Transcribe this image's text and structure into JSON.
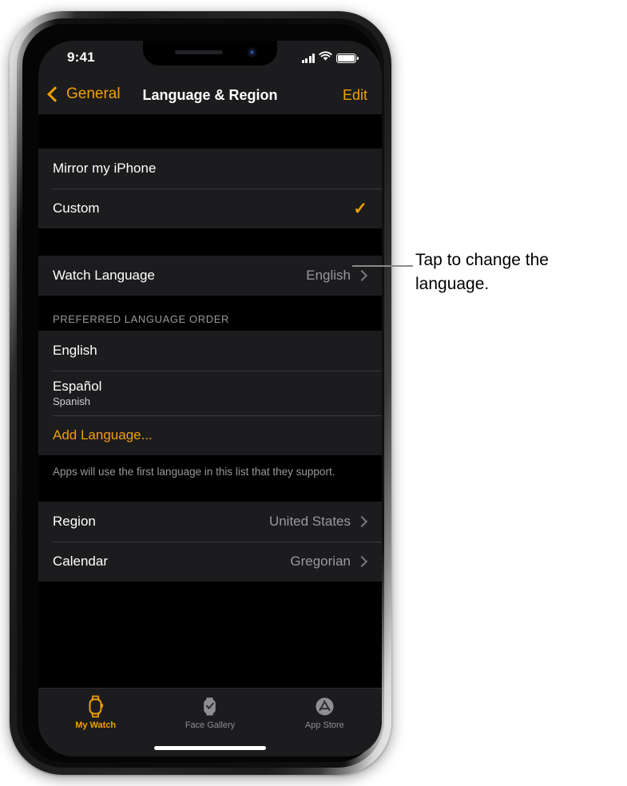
{
  "status_bar": {
    "time": "9:41",
    "signal_icon": "cellular-signal-icon",
    "wifi_icon": "wifi-icon",
    "battery_icon": "battery-icon"
  },
  "nav_bar": {
    "back_label": "General",
    "title": "Language & Region",
    "edit_label": "Edit"
  },
  "groups": {
    "mirror": {
      "rows": [
        {
          "label": "Mirror my iPhone",
          "accessory": "none"
        },
        {
          "label": "Custom",
          "accessory": "checkmark",
          "checkmark": "✓"
        }
      ]
    },
    "watch_language": {
      "rows": [
        {
          "label": "Watch Language",
          "value": "English",
          "accessory": "chevron"
        }
      ]
    },
    "preferred": {
      "header": "PREFERRED LANGUAGE ORDER",
      "rows": [
        {
          "label": "English",
          "sub": ""
        },
        {
          "label": "Español",
          "sub": "Spanish"
        },
        {
          "label": "Add Language...",
          "accent": true
        }
      ],
      "footer": "Apps will use the first language in this list that they support."
    },
    "region": {
      "rows": [
        {
          "label": "Region",
          "value": "United States",
          "accessory": "chevron"
        },
        {
          "label": "Calendar",
          "value": "Gregorian",
          "accessory": "chevron"
        }
      ]
    }
  },
  "tab_bar": {
    "tabs": [
      {
        "label": "My Watch",
        "icon": "watch-outline-icon",
        "active": true
      },
      {
        "label": "Face Gallery",
        "icon": "watch-face-icon",
        "active": false
      },
      {
        "label": "App Store",
        "icon": "app-store-icon",
        "active": false
      }
    ]
  },
  "callout": {
    "text": "Tap to change the language."
  },
  "colors": {
    "accent": "#f0a000",
    "group_background": "#1c1c1e",
    "screen_background": "#000000",
    "secondary_text": "#98989f",
    "page_background": "#ffffff"
  }
}
